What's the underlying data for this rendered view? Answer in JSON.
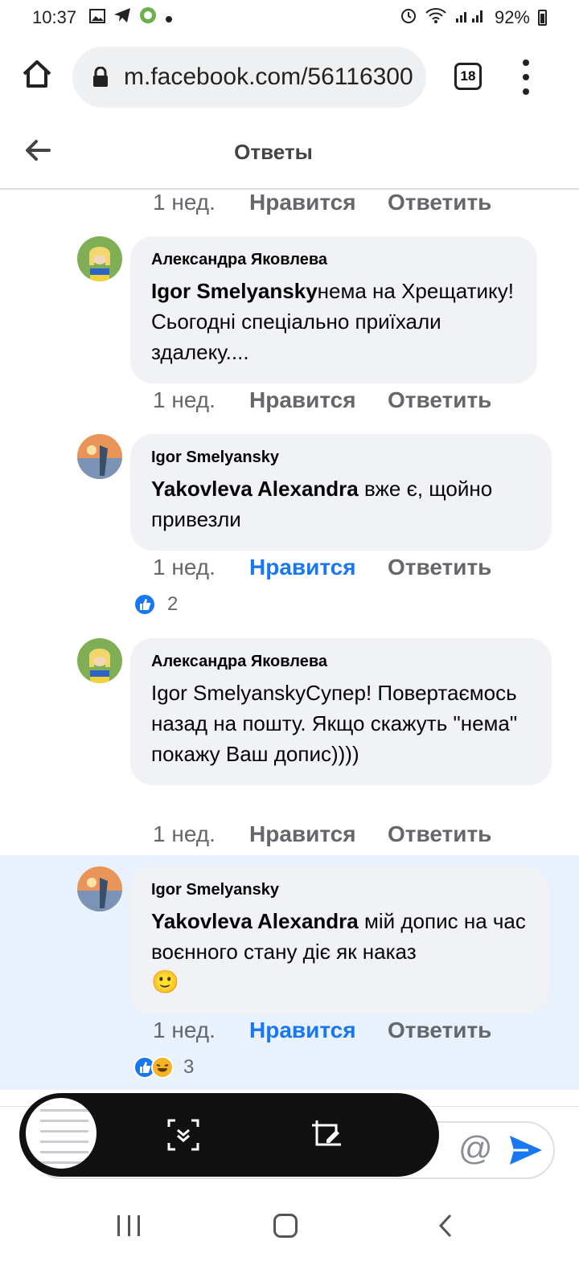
{
  "status_bar": {
    "time": "10:37",
    "battery": "92%",
    "icons": [
      "gallery-icon",
      "telegram-icon",
      "browser-icon",
      "dot-icon",
      "alarm-icon",
      "wifi-icon",
      "signal-icon",
      "battery-icon"
    ]
  },
  "browser": {
    "url": "m.facebook.com/56116300",
    "tab_count": "18"
  },
  "page": {
    "title": "Ответы"
  },
  "comments": [
    {
      "time": "1 нед.",
      "like_label": "Нравится",
      "reply_label": "Ответить",
      "liked": false
    },
    {
      "author": "Александра Яковлева",
      "mention": "Igor Smelyansky",
      "text": "нема на Хрещатику! Сьогодні спеціально приїхали здалеку....",
      "time": "1 нед.",
      "like_label": "Нравится",
      "reply_label": "Ответить",
      "liked": false
    },
    {
      "author": "Igor Smelyansky",
      "mention": "Yakovleva Alexandra",
      "text": " вже є, щойно привезли",
      "time": "1 нед.",
      "like_label": "Нравится",
      "reply_label": "Ответить",
      "liked": true,
      "reaction_count": "2"
    },
    {
      "author": "Александра Яковлева",
      "text": "Igor SmelyanskyСупер! Повертаємось назад на пошту. Якщо скажуть \"нема\" покажу Ваш допис))))",
      "time": "1 нед.",
      "like_label": "Нравится",
      "reply_label": "Ответить",
      "liked": false
    },
    {
      "author": "Igor Smelyansky",
      "mention": "Yakovleva Alexandra",
      "text": " мій допис на час воєнного стану діє як наказ",
      "emoji": "🙂",
      "time": "1 нед.",
      "like_label": "Нравится",
      "reply_label": "Ответить",
      "liked": true,
      "reaction_count": "3"
    }
  ],
  "compose": {
    "at_symbol": "@"
  },
  "colors": {
    "accent": "#1877f2",
    "bubble": "#f0f2f5",
    "highlight": "#e8f1fc",
    "muted": "#65676b"
  }
}
